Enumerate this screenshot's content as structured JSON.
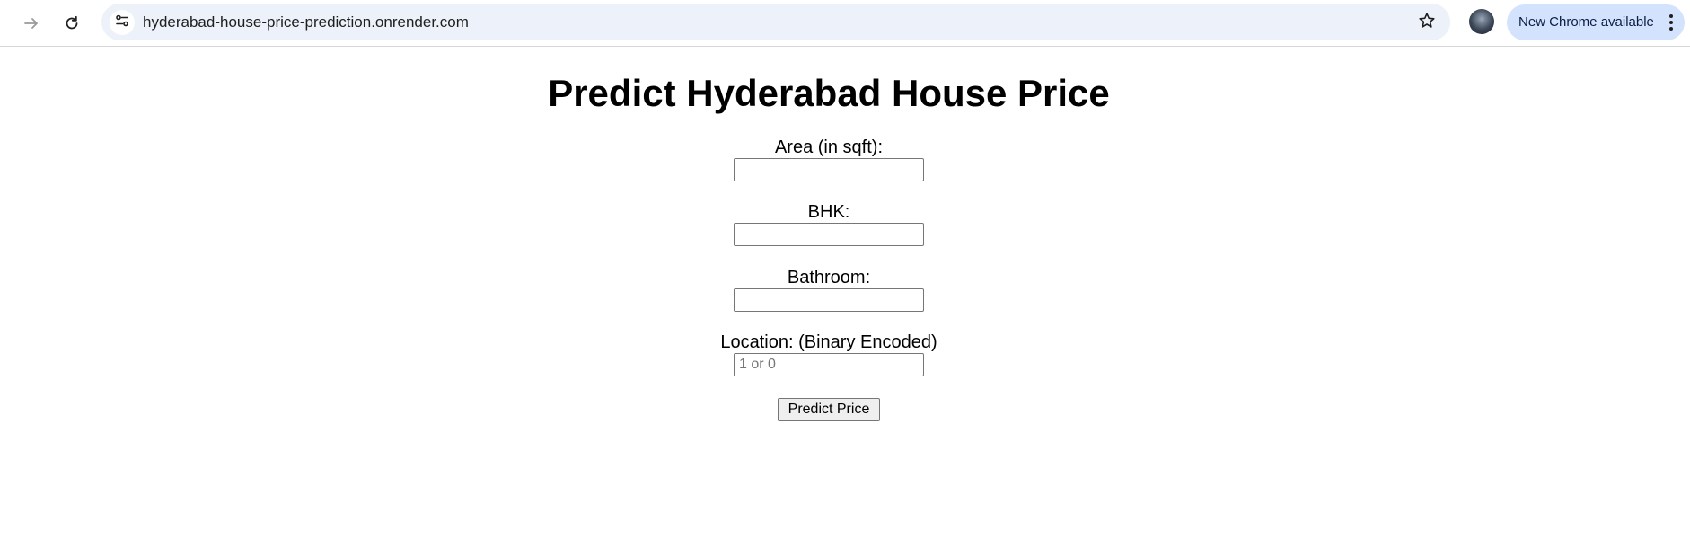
{
  "browser": {
    "url": "hyderabad-house-price-prediction.onrender.com",
    "update_chip_label": "New Chrome available",
    "icons": {
      "forward": "forward-arrow-icon",
      "reload": "reload-icon",
      "site_info": "tune-icon",
      "bookmark": "star-icon",
      "menu": "three-dots-vertical-icon"
    }
  },
  "page": {
    "title": "Predict Hyderabad House Price",
    "fields": [
      {
        "label": "Area (in sqft):",
        "value": "",
        "placeholder": ""
      },
      {
        "label": "BHK:",
        "value": "",
        "placeholder": ""
      },
      {
        "label": "Bathroom:",
        "value": "",
        "placeholder": ""
      },
      {
        "label": "Location: (Binary Encoded)",
        "value": "",
        "placeholder": "1 or 0"
      }
    ],
    "submit_label": "Predict Price"
  },
  "colors": {
    "omnibox_bg": "#edf2fa",
    "update_chip_bg": "#d3e3fd",
    "button_bg": "#efefef"
  }
}
